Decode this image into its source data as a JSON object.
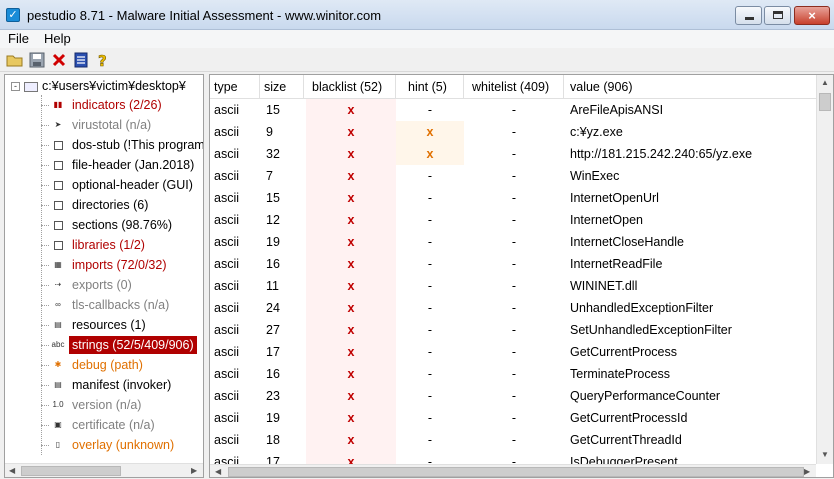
{
  "window": {
    "title": "pestudio 8.71 - Malware Initial Assessment - www.winitor.com",
    "minimize": "minimize",
    "maximize": "maximize",
    "close": "×"
  },
  "menu": {
    "file": "File",
    "help": "Help"
  },
  "toolbar": {
    "icons": [
      "open-folder-icon",
      "save-icon",
      "delete-icon",
      "list-icon",
      "help-icon"
    ]
  },
  "tree": {
    "root_expander": "-",
    "root_label": "c:¥users¥victim¥desktop¥",
    "nodes": [
      {
        "label": "indicators (2/26)",
        "icon": "bar-chart-icon",
        "style": "red"
      },
      {
        "label": "virustotal (n/a)",
        "icon": "arrow-icon",
        "style": "gray"
      },
      {
        "label": "dos-stub (!This program",
        "icon": "box-icon",
        "style": "normal"
      },
      {
        "label": "file-header (Jan.2018)",
        "icon": "box-icon",
        "style": "normal"
      },
      {
        "label": "optional-header (GUI)",
        "icon": "box-icon",
        "style": "normal"
      },
      {
        "label": "directories (6)",
        "icon": "box-icon",
        "style": "normal"
      },
      {
        "label": "sections (98.76%)",
        "icon": "box-icon",
        "style": "normal"
      },
      {
        "label": "libraries (1/2)",
        "icon": "box-icon",
        "style": "red"
      },
      {
        "label": "imports (72/0/32)",
        "icon": "table-icon",
        "style": "red"
      },
      {
        "label": "exports (0)",
        "icon": "export-icon",
        "style": "gray"
      },
      {
        "label": "tls-callbacks (n/a)",
        "icon": "chain-icon",
        "style": "gray"
      },
      {
        "label": "resources (1)",
        "icon": "resources-icon",
        "style": "normal"
      },
      {
        "label": "strings (52/5/409/906)",
        "icon": "abc-icon",
        "style": "selected"
      },
      {
        "label": "debug (path)",
        "icon": "bug-icon",
        "style": "orange"
      },
      {
        "label": "manifest (invoker)",
        "icon": "manifest-icon",
        "style": "normal"
      },
      {
        "label": "version (n/a)",
        "icon": "version-icon",
        "style": "gray"
      },
      {
        "label": "certificate (n/a)",
        "icon": "certificate-icon",
        "style": "gray"
      },
      {
        "label": "overlay (unknown)",
        "icon": "page-icon",
        "style": "orange"
      }
    ]
  },
  "table": {
    "headers": {
      "type": "type",
      "size": "size",
      "blacklist": "blacklist (52)",
      "hint": "hint (5)",
      "whitelist": "whitelist (409)",
      "value": "value (906)"
    },
    "rows": [
      {
        "type": "ascii",
        "size": "15",
        "blacklist": "x",
        "hint": "-",
        "whitelist": "-",
        "value": "AreFileApisANSI"
      },
      {
        "type": "ascii",
        "size": "9",
        "blacklist": "x",
        "hint": "x",
        "whitelist": "-",
        "value": "c:¥yz.exe"
      },
      {
        "type": "ascii",
        "size": "32",
        "blacklist": "x",
        "hint": "x",
        "whitelist": "-",
        "value": "http://181.215.242.240:65/yz.exe"
      },
      {
        "type": "ascii",
        "size": "7",
        "blacklist": "x",
        "hint": "-",
        "whitelist": "-",
        "value": "WinExec"
      },
      {
        "type": "ascii",
        "size": "15",
        "blacklist": "x",
        "hint": "-",
        "whitelist": "-",
        "value": "InternetOpenUrl"
      },
      {
        "type": "ascii",
        "size": "12",
        "blacklist": "x",
        "hint": "-",
        "whitelist": "-",
        "value": "InternetOpen"
      },
      {
        "type": "ascii",
        "size": "19",
        "blacklist": "x",
        "hint": "-",
        "whitelist": "-",
        "value": "InternetCloseHandle"
      },
      {
        "type": "ascii",
        "size": "16",
        "blacklist": "x",
        "hint": "-",
        "whitelist": "-",
        "value": "InternetReadFile"
      },
      {
        "type": "ascii",
        "size": "11",
        "blacklist": "x",
        "hint": "-",
        "whitelist": "-",
        "value": "WININET.dll"
      },
      {
        "type": "ascii",
        "size": "24",
        "blacklist": "x",
        "hint": "-",
        "whitelist": "-",
        "value": "UnhandledExceptionFilter"
      },
      {
        "type": "ascii",
        "size": "27",
        "blacklist": "x",
        "hint": "-",
        "whitelist": "-",
        "value": "SetUnhandledExceptionFilter"
      },
      {
        "type": "ascii",
        "size": "17",
        "blacklist": "x",
        "hint": "-",
        "whitelist": "-",
        "value": "GetCurrentProcess"
      },
      {
        "type": "ascii",
        "size": "16",
        "blacklist": "x",
        "hint": "-",
        "whitelist": "-",
        "value": "TerminateProcess"
      },
      {
        "type": "ascii",
        "size": "23",
        "blacklist": "x",
        "hint": "-",
        "whitelist": "-",
        "value": "QueryPerformanceCounter"
      },
      {
        "type": "ascii",
        "size": "19",
        "blacklist": "x",
        "hint": "-",
        "whitelist": "-",
        "value": "GetCurrentProcessId"
      },
      {
        "type": "ascii",
        "size": "18",
        "blacklist": "x",
        "hint": "-",
        "whitelist": "-",
        "value": "GetCurrentThreadId"
      },
      {
        "type": "ascii",
        "size": "17",
        "blacklist": "x",
        "hint": "-",
        "whitelist": "-",
        "value": "IsDebuggerPresent"
      }
    ]
  },
  "colors": {
    "flagged": "#c00000",
    "hint": "#e07000",
    "selected_bg": "#b00000"
  }
}
